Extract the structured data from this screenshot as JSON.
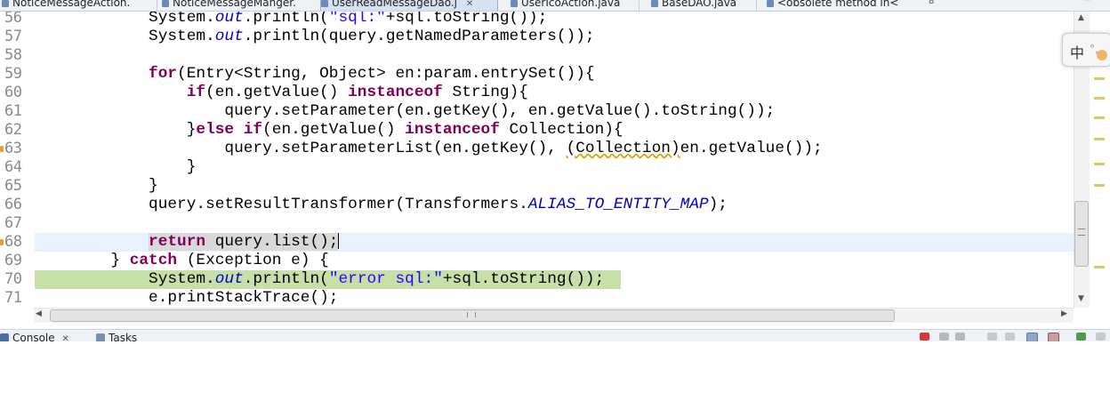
{
  "tabs": [
    {
      "label": "NoticeMessageAction.",
      "active": false
    },
    {
      "label": "NoticeMessageManger.",
      "active": false
    },
    {
      "label": "UserReadMessageDao.j",
      "active": true,
      "close": "✕"
    },
    {
      "label": "UserIcoAction.java",
      "active": false
    },
    {
      "label": "BaseDAO.java",
      "active": false
    },
    {
      "label": "<obsolete method in<",
      "active": false
    }
  ],
  "tab_overflow_count": "8",
  "editor": {
    "lines": [
      {
        "num": "56",
        "marker": false,
        "tokens": [
          {
            "t": "            System."
          },
          {
            "t": "out",
            "c": "st"
          },
          {
            "t": ".println("
          },
          {
            "t": "\"sql:\"",
            "c": "str"
          },
          {
            "t": "+sql.toString());"
          }
        ]
      },
      {
        "num": "57",
        "marker": false,
        "tokens": [
          {
            "t": "            System."
          },
          {
            "t": "out",
            "c": "st"
          },
          {
            "t": ".println(query.getNamedParameters());"
          }
        ]
      },
      {
        "num": "58",
        "marker": false,
        "tokens": [
          {
            "t": ""
          }
        ]
      },
      {
        "num": "59",
        "marker": false,
        "tokens": [
          {
            "t": "            "
          },
          {
            "t": "for",
            "c": "kw"
          },
          {
            "t": "(Entry<String, Object> en:param.entrySet()){"
          }
        ]
      },
      {
        "num": "60",
        "marker": false,
        "tokens": [
          {
            "t": "                "
          },
          {
            "t": "if",
            "c": "kw"
          },
          {
            "t": "(en.getValue() "
          },
          {
            "t": "instanceof",
            "c": "kw"
          },
          {
            "t": " String){"
          }
        ]
      },
      {
        "num": "61",
        "marker": false,
        "tokens": [
          {
            "t": "                    query.setParameter(en.getKey(), en.getValue().toString());"
          }
        ]
      },
      {
        "num": "62",
        "marker": false,
        "tokens": [
          {
            "t": "                }"
          },
          {
            "t": "else",
            "c": "kw"
          },
          {
            "t": " "
          },
          {
            "t": "if",
            "c": "kw"
          },
          {
            "t": "(en.getValue() "
          },
          {
            "t": "instanceof",
            "c": "kw"
          },
          {
            "t": " Collection){"
          }
        ]
      },
      {
        "num": "63",
        "marker": true,
        "tokens": [
          {
            "t": "                    query.setParameterList(en.getKey(), "
          },
          {
            "t": "(Collection)",
            "c": "squig"
          },
          {
            "t": "en.getValue());"
          }
        ]
      },
      {
        "num": "64",
        "marker": false,
        "tokens": [
          {
            "t": "                }"
          }
        ]
      },
      {
        "num": "65",
        "marker": false,
        "tokens": [
          {
            "t": "            }"
          }
        ]
      },
      {
        "num": "66",
        "marker": false,
        "tokens": [
          {
            "t": "            query.setResultTransformer(Transformers."
          },
          {
            "t": "ALIAS_TO_ENTITY_MAP",
            "c": "st"
          },
          {
            "t": ");"
          }
        ]
      },
      {
        "num": "67",
        "marker": false,
        "tokens": [
          {
            "t": ""
          }
        ]
      },
      {
        "num": "68",
        "marker": true,
        "current": true,
        "tokens": [
          {
            "t": "            "
          },
          {
            "t": "return",
            "c": "kw hl-gray"
          },
          {
            "t": " query.list();",
            "c": "hl-gray"
          },
          {
            "caret": true
          }
        ]
      },
      {
        "num": "69",
        "marker": false,
        "tokens": [
          {
            "t": "        } "
          },
          {
            "t": "catch",
            "c": "kw"
          },
          {
            "t": " (Exception e) {"
          }
        ]
      },
      {
        "num": "70",
        "marker": false,
        "green": true,
        "tokens": [
          {
            "t": "            System."
          },
          {
            "t": "out",
            "c": "st"
          },
          {
            "t": ".println("
          },
          {
            "t": "\"error sql:\"",
            "c": "str"
          },
          {
            "t": "+sql.toString());"
          }
        ]
      },
      {
        "num": "71",
        "marker": false,
        "tokens": [
          {
            "t": "            e.printStackTrace();"
          }
        ]
      }
    ]
  },
  "ime": {
    "text": "中",
    "dot": "°,"
  },
  "bottom_tabs": [
    {
      "label": "Console",
      "close": "✕"
    },
    {
      "label": "Tasks"
    }
  ],
  "colors": {
    "keyword": "#7f0055",
    "string": "#2a00ff",
    "static": "#0000c0",
    "current_line": "#e8f2fe",
    "green_highlight": "#c7dfa8"
  }
}
